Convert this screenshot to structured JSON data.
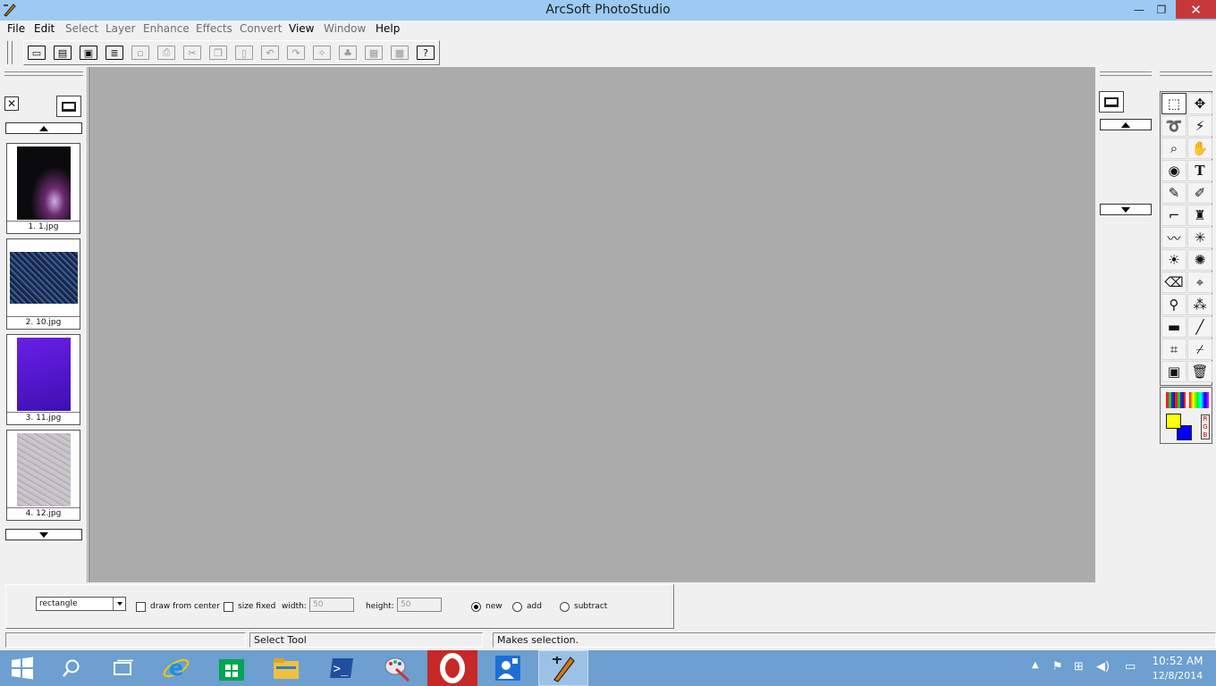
{
  "window": {
    "title": "ArcSoft PhotoStudio",
    "minimize_glyph": "—",
    "maximize_glyph": "❐",
    "close_glyph": "✕"
  },
  "menu": [
    {
      "label": "File",
      "enabled": true
    },
    {
      "label": "Edit",
      "enabled": true
    },
    {
      "label": "Select",
      "enabled": false
    },
    {
      "label": "Layer",
      "enabled": false
    },
    {
      "label": "Enhance",
      "enabled": false
    },
    {
      "label": "Effects",
      "enabled": false
    },
    {
      "label": "Convert",
      "enabled": false
    },
    {
      "label": "View",
      "enabled": true
    },
    {
      "label": "Window",
      "enabled": false
    },
    {
      "label": "Help",
      "enabled": true
    }
  ],
  "toolbar": {
    "buttons": [
      {
        "icon": "new-file-icon",
        "glyph": "▭",
        "enabled": true
      },
      {
        "icon": "open-folder-icon",
        "glyph": "▤",
        "enabled": true
      },
      {
        "icon": "acquire-icon",
        "glyph": "▣",
        "enabled": true
      },
      {
        "icon": "scan-icon",
        "glyph": "≣",
        "enabled": true
      },
      {
        "icon": "save-icon",
        "glyph": "▫",
        "enabled": false
      },
      {
        "icon": "print-icon",
        "glyph": "⎙",
        "enabled": false
      },
      {
        "icon": "cut-icon",
        "glyph": "✂",
        "enabled": false
      },
      {
        "icon": "copy-icon",
        "glyph": "❐",
        "enabled": false
      },
      {
        "icon": "paste-icon",
        "glyph": "▯",
        "enabled": false
      },
      {
        "icon": "undo-icon",
        "glyph": "↶",
        "enabled": false
      },
      {
        "icon": "redo-icon",
        "glyph": "↷",
        "enabled": false
      },
      {
        "icon": "wand-icon",
        "glyph": "✧",
        "enabled": false
      },
      {
        "icon": "stamp-icon",
        "glyph": "♣",
        "enabled": false
      },
      {
        "icon": "ruler-icon",
        "glyph": "▦",
        "enabled": false
      },
      {
        "icon": "film-icon",
        "glyph": "▩",
        "enabled": false
      },
      {
        "icon": "help-icon",
        "glyph": "?",
        "enabled": true
      }
    ]
  },
  "album": {
    "close_glyph": "✕",
    "thumbnails": [
      {
        "label": "1. 1.jpg",
        "colors": [
          "#0b0b0d",
          "#6a2a6e",
          "#cfb0e8"
        ]
      },
      {
        "label": "2. 10.jpg",
        "colors": [
          "#1c2d52",
          "#3b5d92",
          "#0e1630"
        ]
      },
      {
        "label": "3. 11.jpg",
        "colors": [
          "#4f16c8",
          "#6a1fe6",
          "#3d0fb0"
        ]
      },
      {
        "label": "4. 12.jpg",
        "colors": [
          "#cfc7c0",
          "#8fb3a8",
          "#d6b8c8"
        ]
      }
    ]
  },
  "tools": [
    {
      "name": "rect-select-tool",
      "glyph": "⬚"
    },
    {
      "name": "move-tool",
      "glyph": "✥"
    },
    {
      "name": "lasso-tool",
      "glyph": "➰"
    },
    {
      "name": "magic-wand-tool",
      "glyph": "⚡"
    },
    {
      "name": "zoom-tool",
      "glyph": "⌕"
    },
    {
      "name": "hand-tool",
      "glyph": "✋"
    },
    {
      "name": "red-eye-tool",
      "glyph": "◉"
    },
    {
      "name": "text-tool",
      "glyph": "T"
    },
    {
      "name": "pencil-tool",
      "glyph": "✎"
    },
    {
      "name": "brush-tool",
      "glyph": "✐"
    },
    {
      "name": "airbrush-tool",
      "glyph": "⌐"
    },
    {
      "name": "spray-can-tool",
      "glyph": "♜"
    },
    {
      "name": "smudge-tool",
      "glyph": "〰"
    },
    {
      "name": "blur-tool",
      "glyph": "✳"
    },
    {
      "name": "dodge-tool",
      "glyph": "☀"
    },
    {
      "name": "sharpen-tool",
      "glyph": "✺"
    },
    {
      "name": "eraser-tool",
      "glyph": "⌫"
    },
    {
      "name": "clone-tool",
      "glyph": "⌖"
    },
    {
      "name": "stamp-tool",
      "glyph": "⚲"
    },
    {
      "name": "scatter-tool",
      "glyph": "⁂"
    },
    {
      "name": "gradient-tool",
      "glyph": "▬"
    },
    {
      "name": "line-tool",
      "glyph": "╱"
    },
    {
      "name": "crop-tool",
      "glyph": "⌗"
    },
    {
      "name": "eyedropper-tool",
      "glyph": "⌿"
    },
    {
      "name": "transform-tool",
      "glyph": "▣"
    },
    {
      "name": "trash-tool",
      "glyph": "🗑"
    }
  ],
  "colors": {
    "foreground": "#ffff00",
    "background": "#0000ff",
    "rgb_label": "RGB"
  },
  "options": {
    "shape": "rectangle",
    "draw_from_center": "draw from center",
    "size_fixed": "size fixed",
    "width_label": "width:",
    "width_value": "50",
    "height_label": "height:",
    "height_value": "50",
    "mode_new": "new",
    "mode_add": "add",
    "mode_subtract": "subtract",
    "selected_mode": "new"
  },
  "status": {
    "pane1": "",
    "tool": "Select Tool",
    "hint": "Makes selection."
  },
  "taskbar": {
    "items": [
      {
        "icon": "windows-start-icon",
        "glyph": "⊞"
      },
      {
        "icon": "search-icon",
        "glyph": "⌕"
      },
      {
        "icon": "task-view-icon",
        "glyph": "❐"
      },
      {
        "icon": "internet-explorer-icon",
        "glyph": "e"
      },
      {
        "icon": "store-icon",
        "glyph": "▦"
      },
      {
        "icon": "file-explorer-icon",
        "glyph": "▬"
      },
      {
        "icon": "powershell-icon",
        "glyph": "❯"
      },
      {
        "icon": "paint-app-icon",
        "glyph": "✎"
      },
      {
        "icon": "opera-icon",
        "glyph": "O"
      },
      {
        "icon": "contacts-app-icon",
        "glyph": "☗"
      },
      {
        "icon": "photostudio-icon",
        "glyph": "✐"
      }
    ],
    "time": "10:52 AM",
    "date": "12/8/2014"
  }
}
